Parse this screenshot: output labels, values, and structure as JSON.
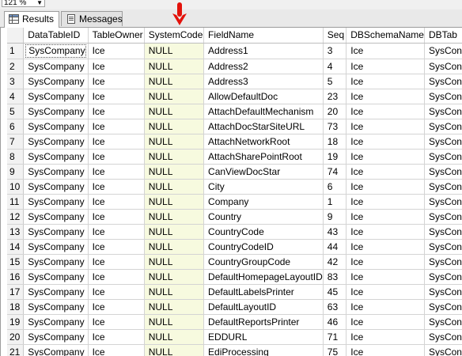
{
  "toolbar": {
    "zoom": "121 %"
  },
  "tabs": [
    {
      "label": "Results",
      "active": true
    },
    {
      "label": "Messages",
      "active": false
    }
  ],
  "grid": {
    "columns": [
      "DataTableID",
      "TableOwner",
      "SystemCode",
      "FieldName",
      "Seq",
      "DBSchemaName",
      "DBTab"
    ],
    "rows": [
      [
        "1",
        "SysCompany",
        "Ice",
        "NULL",
        "Address1",
        "3",
        "Ice",
        "SysCon"
      ],
      [
        "2",
        "SysCompany",
        "Ice",
        "NULL",
        "Address2",
        "4",
        "Ice",
        "SysCon"
      ],
      [
        "3",
        "SysCompany",
        "Ice",
        "NULL",
        "Address3",
        "5",
        "Ice",
        "SysCon"
      ],
      [
        "4",
        "SysCompany",
        "Ice",
        "NULL",
        "AllowDefaultDoc",
        "23",
        "Ice",
        "SysCon"
      ],
      [
        "5",
        "SysCompany",
        "Ice",
        "NULL",
        "AttachDefaultMechanism",
        "20",
        "Ice",
        "SysCon"
      ],
      [
        "6",
        "SysCompany",
        "Ice",
        "NULL",
        "AttachDocStarSiteURL",
        "73",
        "Ice",
        "SysCon"
      ],
      [
        "7",
        "SysCompany",
        "Ice",
        "NULL",
        "AttachNetworkRoot",
        "18",
        "Ice",
        "SysCon"
      ],
      [
        "8",
        "SysCompany",
        "Ice",
        "NULL",
        "AttachSharePointRoot",
        "19",
        "Ice",
        "SysCon"
      ],
      [
        "9",
        "SysCompany",
        "Ice",
        "NULL",
        "CanViewDocStar",
        "74",
        "Ice",
        "SysCon"
      ],
      [
        "10",
        "SysCompany",
        "Ice",
        "NULL",
        "City",
        "6",
        "Ice",
        "SysCon"
      ],
      [
        "11",
        "SysCompany",
        "Ice",
        "NULL",
        "Company",
        "1",
        "Ice",
        "SysCon"
      ],
      [
        "12",
        "SysCompany",
        "Ice",
        "NULL",
        "Country",
        "9",
        "Ice",
        "SysCon"
      ],
      [
        "13",
        "SysCompany",
        "Ice",
        "NULL",
        "CountryCode",
        "43",
        "Ice",
        "SysCon"
      ],
      [
        "14",
        "SysCompany",
        "Ice",
        "NULL",
        "CountryCodeID",
        "44",
        "Ice",
        "SysCon"
      ],
      [
        "15",
        "SysCompany",
        "Ice",
        "NULL",
        "CountryGroupCode",
        "42",
        "Ice",
        "SysCon"
      ],
      [
        "16",
        "SysCompany",
        "Ice",
        "NULL",
        "DefaultHomepageLayoutID",
        "83",
        "Ice",
        "SysCon"
      ],
      [
        "17",
        "SysCompany",
        "Ice",
        "NULL",
        "DefaultLabelsPrinter",
        "45",
        "Ice",
        "SysCon"
      ],
      [
        "18",
        "SysCompany",
        "Ice",
        "NULL",
        "DefaultLayoutID",
        "63",
        "Ice",
        "SysCon"
      ],
      [
        "19",
        "SysCompany",
        "Ice",
        "NULL",
        "DefaultReportsPrinter",
        "46",
        "Ice",
        "SysCon"
      ],
      [
        "20",
        "SysCompany",
        "Ice",
        "NULL",
        "EDDURL",
        "71",
        "Ice",
        "SysCon"
      ],
      [
        "21",
        "SysCompany",
        "Ice",
        "NULL",
        "EdiProcessing",
        "75",
        "Ice",
        "SysCon"
      ]
    ]
  },
  "colors": {
    "highlight_column": "#f7fadf",
    "arrow": "#e3120b"
  },
  "icons": {
    "results_tab": "grid-icon",
    "messages_tab": "document-icon",
    "annotation": "red-down-arrow-icon"
  }
}
